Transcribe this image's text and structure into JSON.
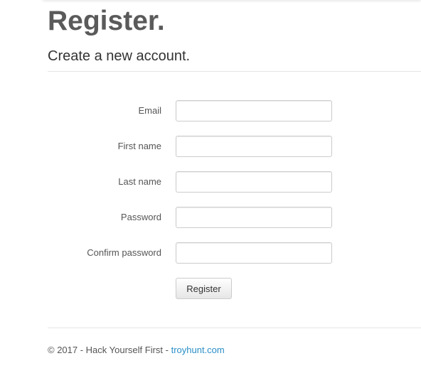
{
  "page": {
    "title": "Register.",
    "subtitle": "Create a new account."
  },
  "form": {
    "fields": [
      {
        "label": "Email",
        "value": ""
      },
      {
        "label": "First name",
        "value": ""
      },
      {
        "label": "Last name",
        "value": ""
      },
      {
        "label": "Password",
        "value": ""
      },
      {
        "label": "Confirm password",
        "value": ""
      }
    ],
    "submit_label": "Register"
  },
  "footer": {
    "text": "© 2017 - Hack Yourself First - ",
    "link": "troyhunt.com",
    "link_color": "#2a8ec8"
  }
}
